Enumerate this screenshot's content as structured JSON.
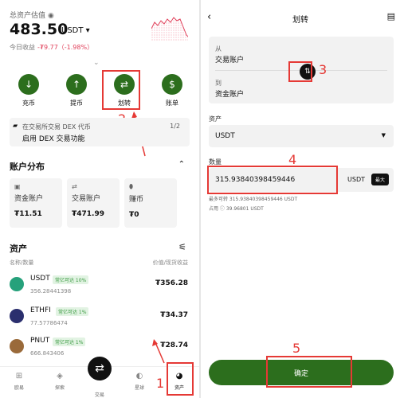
{
  "left": {
    "total_label": "总资产估值",
    "total_value": "483.50",
    "total_unit": "USDT ▾",
    "today_label": "今日收益",
    "today_change": "-₮9.77（-1.98%）",
    "actions": [
      {
        "icon": "deposit-icon",
        "glyph": "↓",
        "label": "充币"
      },
      {
        "icon": "withdraw-icon",
        "glyph": "↑",
        "label": "提币"
      },
      {
        "icon": "transfer-icon",
        "glyph": "⇄",
        "label": "划转"
      },
      {
        "icon": "bill-icon",
        "glyph": "$",
        "label": "账单"
      }
    ],
    "promo": {
      "line1": "在交易所交易 DEX 代币",
      "line2": "启用 DEX 交易功能",
      "page": "1/2"
    },
    "account_title": "账户分布",
    "accounts": [
      {
        "name": "资金账户",
        "value": "₮11.51"
      },
      {
        "name": "交易账户",
        "value": "₮471.99"
      },
      {
        "name": "赚币",
        "value": "₮0"
      }
    ],
    "assets_title": "资产",
    "col_left": "名称/数量",
    "col_right": "价值/现货收益",
    "assets": [
      {
        "symbol": "USDT",
        "tag": "常亿可达 10%",
        "amount": "356.28441398",
        "value": "₮356.28",
        "color": "#26a17b"
      },
      {
        "symbol": "ETHFI",
        "tag": "常亿可达 1%",
        "amount": "77.57786474",
        "value": "₮34.37",
        "color": "#2b2f6e"
      },
      {
        "symbol": "PNUT",
        "tag": "常亿可达 1%",
        "amount": "666.843406",
        "value": "₮28.74",
        "color": "#9a6a3a"
      }
    ],
    "nav": [
      {
        "icon": "grid-icon",
        "glyph": "⊞",
        "label": "欧易"
      },
      {
        "icon": "compass-icon",
        "glyph": "◈",
        "label": "探索"
      },
      {
        "icon": "trade-icon",
        "glyph": "⇄",
        "label": "交易"
      },
      {
        "icon": "planet-icon",
        "glyph": "◐",
        "label": "星球"
      },
      {
        "icon": "pie-chart-icon",
        "glyph": "◕",
        "label": "资产"
      }
    ],
    "annotations": [
      "1",
      "2"
    ]
  },
  "right": {
    "title": "划转",
    "from_label": "从",
    "from_value": "交易账户",
    "to_label": "到",
    "to_value": "资金账户",
    "asset_label": "资产",
    "asset_value": "USDT",
    "amount_label": "数量",
    "amount_value": "315.93840398459446",
    "amount_unit": "USDT",
    "max_label": "最大",
    "max_transfer": "最多可转  315.93840398459446 USDT",
    "occupied": "占用 ⓘ  39.96801 USDT",
    "confirm_label": "确定",
    "annotations": [
      "3",
      "4",
      "5"
    ]
  },
  "colors": {
    "accent": "#2c6e1d",
    "annotation": "#e53935",
    "negative": "#e0405a"
  }
}
